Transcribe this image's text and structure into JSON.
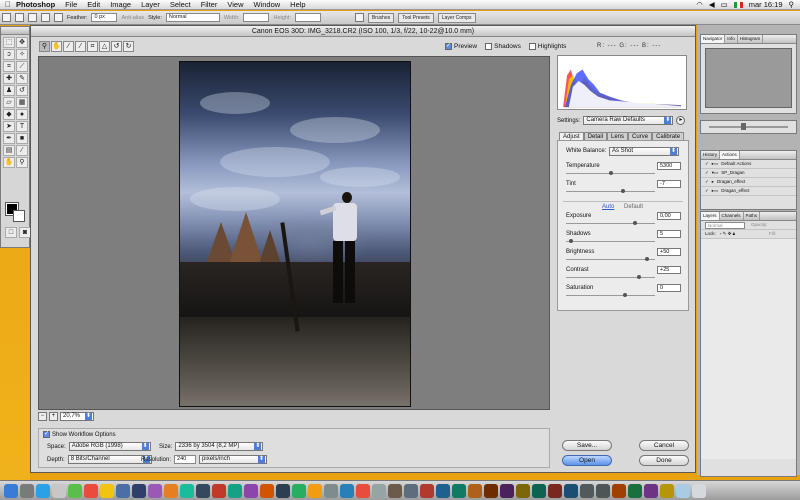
{
  "menubar": {
    "app": "Photoshop",
    "items": [
      "File",
      "Edit",
      "Image",
      "Layer",
      "Select",
      "Filter",
      "View",
      "Window",
      "Help"
    ],
    "clock": "mar 16:19"
  },
  "options_bar": {
    "feather_label": "Feather:",
    "feather_value": "0 px",
    "antialias_label": "Anti-alias",
    "style_label": "Style:",
    "style_value": "Normal",
    "width_label": "Width:",
    "height_label": "Height:",
    "palette_tabs": [
      "Brushes",
      "Tool Presets",
      "Layer Comps"
    ]
  },
  "dialog": {
    "title": "Canon EOS 30D:  IMG_3218.CR2  (ISO 100, 1/3, f/22, 10-22@10.0 mm)",
    "preview_label": "Preview",
    "shadows_label": "Shadows",
    "highlights_label": "Highlights",
    "rgb_readout": "R: ---  G: ---  B: ---",
    "zoom_value": "20,7%"
  },
  "settings": {
    "label": "Settings:",
    "value": "Camera Raw Defaults",
    "tabs": [
      "Adjust",
      "Detail",
      "Lens",
      "Curve",
      "Calibrate"
    ]
  },
  "adjust": {
    "white_balance_label": "White Balance:",
    "white_balance_value": "As Shot",
    "temperature_label": "Temperature",
    "temperature_value": "5300",
    "tint_label": "Tint",
    "tint_value": "-7",
    "auto_label": "Auto",
    "default_label": "Default",
    "exposure_label": "Exposure",
    "exposure_value": "0,00",
    "shadows_label": "Shadows",
    "shadows_value": "5",
    "brightness_label": "Brightness",
    "brightness_value": "+50",
    "contrast_label": "Contrast",
    "contrast_value": "+25",
    "saturation_label": "Saturation",
    "saturation_value": "0"
  },
  "workflow": {
    "toggle_label": "Show Workflow Options",
    "space_label": "Space:",
    "space_value": "Adobe RGB (1998)",
    "size_label": "Size:",
    "size_value": "2336 by 3504  (8,2 MP)",
    "depth_label": "Depth:",
    "depth_value": "8 Bits/Channel",
    "resolution_label": "Resolution:",
    "resolution_value": "240",
    "resolution_unit": "pixels/inch"
  },
  "buttons": {
    "save": "Save...",
    "cancel": "Cancel",
    "open": "Open",
    "done": "Done"
  },
  "palettes": {
    "navigator_tabs": [
      "Navigator",
      "Info",
      "Histogram"
    ],
    "history_tabs": [
      "History",
      "Actions"
    ],
    "actions": [
      "Default Actions",
      "SP_Dragan",
      "Dragan_effect",
      "Dragan_effect"
    ],
    "layers_tabs": [
      "Layers",
      "Channels",
      "Paths"
    ],
    "blend_mode": "Normal",
    "opacity_label": "Opacity:",
    "lock_label": "Lock:",
    "fill_label": "Fill:"
  },
  "colors": {
    "accent": "#4d7ed8",
    "wallpaper": "#e8a20f"
  }
}
